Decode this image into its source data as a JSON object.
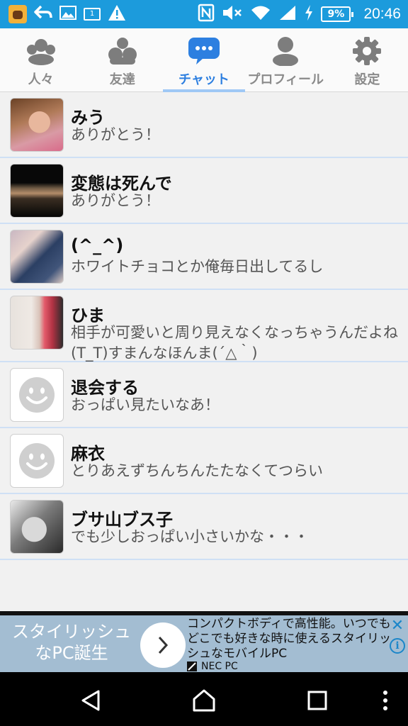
{
  "status_bar": {
    "battery_percent": "9%",
    "time": "20:46",
    "icons": [
      "app-icon",
      "back-arrow-icon",
      "image-icon",
      "sim-icon",
      "warning-icon",
      "nfc-icon",
      "mute-icon",
      "wifi-icon",
      "signal-icon",
      "charging-icon",
      "battery-icon"
    ]
  },
  "tabs": [
    {
      "label": "人々",
      "icon": "people-icon",
      "active": false
    },
    {
      "label": "友達",
      "icon": "friends-icon",
      "active": false
    },
    {
      "label": "チャット",
      "icon": "chat-bubble-icon",
      "active": true
    },
    {
      "label": "プロフィール",
      "icon": "profile-icon",
      "active": false
    },
    {
      "label": "設定",
      "icon": "gear-icon",
      "active": false
    }
  ],
  "chats": [
    {
      "name": "みう",
      "message": "ありがとう！",
      "avatar": "photo"
    },
    {
      "name": "変態は死んで",
      "message": "ありがとう！",
      "avatar": "photo"
    },
    {
      "name": "(^_^)",
      "message": "ホワイトチョコとか俺毎日出してるし",
      "avatar": "photo"
    },
    {
      "name": "ひま",
      "message": "相手が可愛いと周り見えなくなっちゃうんだよね(T_T)すまんなほんま(´△｀)",
      "avatar": "photo"
    },
    {
      "name": "退会する",
      "message": "おっぱい見たいなあ！",
      "avatar": "smiley-placeholder"
    },
    {
      "name": "麻衣",
      "message": "とりあえずちんちんたたなくてつらい",
      "avatar": "smiley-placeholder"
    },
    {
      "name": "ブサ山ブス子",
      "message": "でも少しおっぱい小さいかな・・・",
      "avatar": "photo"
    }
  ],
  "ad": {
    "headline": "スタイリッシュなPC誕生",
    "body": "コンパクトボディで高性能。いつでもどこでも好きな時に使えるスタイリッシュなモバイルPC",
    "advertiser": "NEC PC",
    "colors": {
      "background": "#a3bdd2",
      "accent": "#1b86c9"
    }
  },
  "colors": {
    "status_bar": "#1c9bdc",
    "active_tab": "#2d7fe0",
    "row_divider": "#cfe0f5"
  }
}
